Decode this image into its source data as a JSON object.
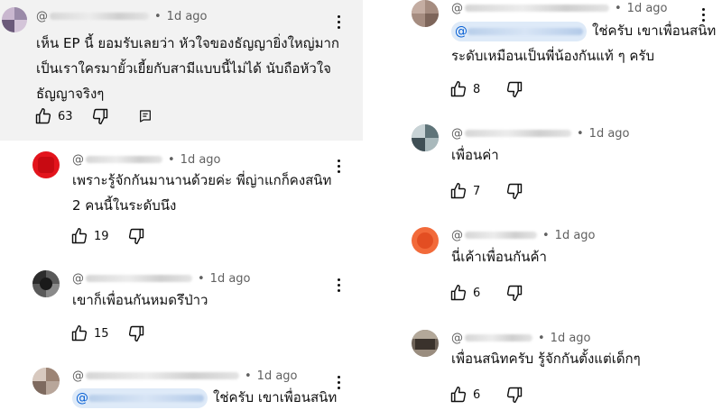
{
  "comments": [
    {
      "id": "c1",
      "time": "1d ago",
      "lines": [
        "เห็น EP นี้ ยอมรับเลยว่า หัวใจของธัญญายิ่งใหญ่มาก",
        "เป็นเราใครมายั้วเยี้ยกับสามีแบบนี้ไม่ได้ นับถือหัวใจ",
        "ธัญญาจริงๆ"
      ],
      "likes": "63"
    },
    {
      "id": "c2",
      "time": "1d ago",
      "lines": [
        "เพราะรู้จักกันมานานด้วยค่ะ พี่ญ่าแกก็คงสนิท",
        "2 คนนี้ในระดับนึง"
      ],
      "likes": "19"
    },
    {
      "id": "c3",
      "time": "1d ago",
      "lines": [
        "เขาก็เพื่อนกันหมดรึป่าว"
      ],
      "likes": "15"
    },
    {
      "id": "c4",
      "time": "1d ago",
      "text": "ใช่ครับ เขาเพื่อนสนิท"
    },
    {
      "id": "c5",
      "time": "1d ago",
      "text": "ใช่ครับ เขาเพื่อนสนิท",
      "line2": "ระดับเหมือนเป็นพี่น้องกันแท้ ๆ ครับ",
      "likes": "8"
    },
    {
      "id": "c6",
      "time": "1d ago",
      "text": "เพื่อนค่า",
      "likes": "7"
    },
    {
      "id": "c7",
      "time": "1d ago",
      "text": "นี่เค้าเพื่อนกันค้า",
      "likes": "6"
    },
    {
      "id": "c8",
      "time": "1d ago",
      "text": "เพื่อนสนิทครับ รู้จักกันตั้งแต่เด็กๆ",
      "likes": "6"
    }
  ],
  "at_symbol": "@",
  "separator": "•",
  "icons": {
    "like": "thumb-up-icon",
    "dislike": "thumb-down-icon",
    "reply": "reply-icon",
    "menu": "more-vert-icon"
  }
}
